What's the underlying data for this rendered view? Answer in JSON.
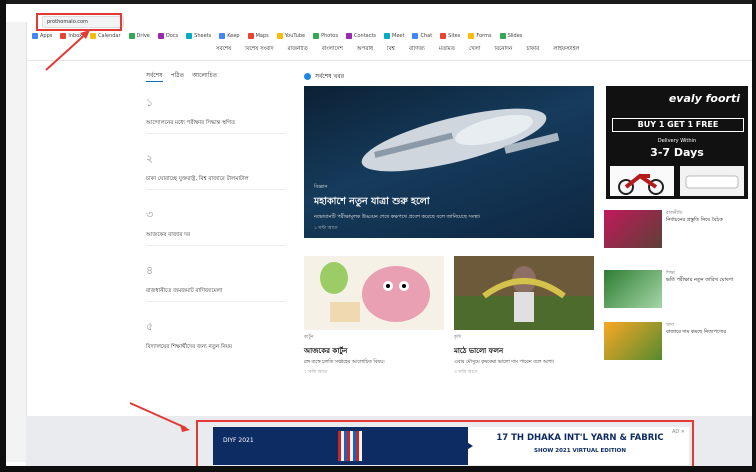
{
  "browser": {
    "url": "prothomalo.com",
    "bookmarks": [
      "Apps",
      "Inbox",
      "Calendar",
      "Drive",
      "Docs",
      "Sheets",
      "Keep",
      "Maps",
      "YouTube",
      "Photos",
      "Contacts",
      "Meet",
      "Chat",
      "Sites",
      "Forms",
      "Slides"
    ]
  },
  "site": {
    "nav": [
      "সর্বশেষ",
      "বিশেষ সংবাদ",
      "রাজনীতি",
      "বাংলাদেশ",
      "অপরাধ",
      "বিশ্ব",
      "বাণিজ্য",
      "মতামত",
      "খেলা",
      "বিনোদন",
      "চাকরি",
      "লাইফস্টাইল"
    ],
    "left_tabs": [
      "সর্বশেষ",
      "পঠিত",
      "আলোচিত"
    ],
    "left_items": [
      {
        "num": "১",
        "text": "আন্দোলনের মধ্যে পরীক্ষার সিদ্ধান্ত স্থগিত"
      },
      {
        "num": "২",
        "text": "চাকা ঘোরাচ্ছে যুক্তরাষ্ট্র, বিশ্ব বাজারে টালমাটাল"
      },
      {
        "num": "৩",
        "text": "আজকের বাজার দর"
      },
      {
        "num": "৪",
        "text": "রাজধানীতে জমজমাট বাণিজ্যমেলা"
      },
      {
        "num": "৫",
        "text": "বিদ্যালয়ের শিক্ষার্থীদের জন্য নতুন নিয়ম"
      }
    ],
    "live_label": "সর্বশেষ খবর",
    "hero": {
      "kicker": "বিজ্ঞান",
      "title": "মহাকাশে নতুন যাত্রা শুরু হলো",
      "sub": "নভোযানটি পরীক্ষামূলক উড্ডয়ন শেষে কক্ষপথে প্রবেশ করেছে বলে জানিয়েছে সংস্থা।",
      "time": "১ ঘণ্টা আগে"
    },
    "cards": [
      {
        "kicker": "কার্টুন",
        "title": "আজকের কার্টুন",
        "sub": "রঙ্গ ব্যঙ্গে চলতি সপ্তাহের আলোচিত বিষয়।",
        "time": "২ ঘণ্টা আগে"
      },
      {
        "kicker": "কৃষি",
        "title": "মাঠে ভালো ফলন",
        "sub": "এবার মৌসুমে কৃষকেরা ভালো দাম পাবেন বলে আশা।",
        "time": "৩ ঘণ্টা আগে"
      }
    ],
    "right_news": [
      {
        "kicker": "রাজনীতি",
        "text": "নির্বাচনের প্রস্তুতি নিয়ে বৈঠক"
      },
      {
        "kicker": "শিক্ষা",
        "text": "ভর্তি পরীক্ষার নতুন তারিখ ঘোষণা"
      },
      {
        "kicker": "খাদ্য",
        "text": "বাজারে দাম কমছে নিত্যপণ্যের"
      }
    ],
    "ad_top": {
      "brand": "evaly foorti",
      "promo": "BUY 1 GET 1 FREE",
      "deliv": "Delivery Within",
      "days": "3-7 Days"
    },
    "banner": {
      "logo": "DIYF 2021",
      "h1": "17 TH DHAKA INT'L YARN & FABRIC",
      "h2": "SHOW 2021 VIRTUAL EDITION",
      "adx": "AD ✕"
    }
  },
  "colors": {
    "accent": "#e53935",
    "navy": "#0d2c63",
    "live": "#1e88e5"
  }
}
